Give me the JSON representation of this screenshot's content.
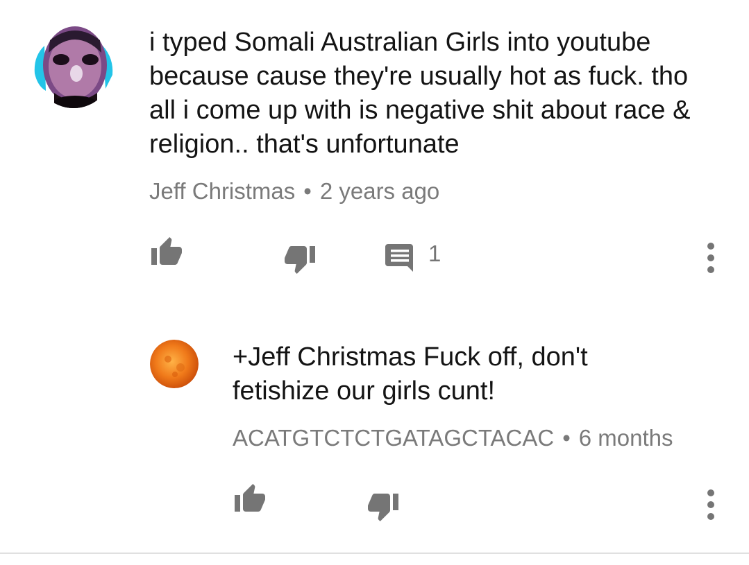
{
  "comments": [
    {
      "text": "i typed Somali Australian Girls into youtube because cause they're usually hot as fuck. tho all i come up with is negative shit about race & religion.. that's unfortunate",
      "author": "Jeff Christmas",
      "separator": "•",
      "time": "2 years ago",
      "reply_count": "1",
      "icons": {
        "like": "thumbs-up-icon",
        "dislike": "thumbs-down-icon",
        "reply": "comment-icon",
        "more": "more-vert-icon"
      }
    },
    {
      "text": "+Jeff Christmas Fuck off, don't fetishize our girls cunt!",
      "author": "ACATGTCTCTGATAGCTACAC",
      "separator": "•",
      "time": "6 months",
      "icons": {
        "like": "thumbs-up-icon",
        "dislike": "thumbs-down-icon",
        "more": "more-vert-icon"
      }
    }
  ],
  "colors": {
    "text": "#141414",
    "meta": "#7a7a7a",
    "icon": "#757575",
    "divider": "#e0e0e0"
  }
}
